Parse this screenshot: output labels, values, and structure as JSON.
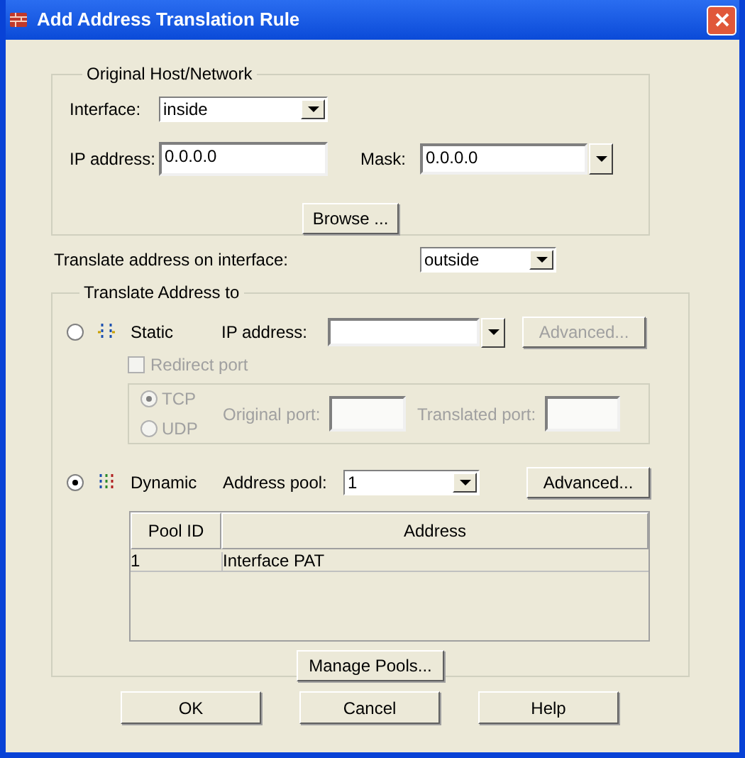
{
  "window": {
    "title": "Add Address Translation Rule"
  },
  "original": {
    "legend": "Original Host/Network",
    "interface_label": "Interface:",
    "interface_value": "inside",
    "ip_label": "IP address:",
    "ip_value": "0.0.0.0",
    "mask_label": "Mask:",
    "mask_value": "0.0.0.0",
    "browse": "Browse ..."
  },
  "translate_interface": {
    "label": "Translate address on interface:",
    "value": "outside"
  },
  "translate_to": {
    "legend": "Translate Address to",
    "static": {
      "label": "Static",
      "selected": false,
      "ip_label": "IP address:",
      "advanced": {
        "label": "Advanced...",
        "disabled": true
      }
    },
    "redirect_port": {
      "label": "Redirect port",
      "checked": false,
      "disabled": true
    },
    "protocols": [
      {
        "label": "TCP",
        "selected": true,
        "disabled": true
      },
      {
        "label": "UDP",
        "selected": false,
        "disabled": true
      }
    ],
    "ports": {
      "disabled": true,
      "original_label": "Original port:",
      "translated_label": "Translated port:"
    },
    "dynamic": {
      "label": "Dynamic",
      "selected": true,
      "pool_label": "Address pool:",
      "pool_value": "1",
      "advanced": {
        "label": "Advanced...",
        "disabled": false
      }
    },
    "table": {
      "columns": [
        "Pool ID",
        "Address"
      ],
      "rows": [
        [
          "1",
          "Interface PAT"
        ]
      ]
    },
    "manage_pools": "Manage Pools..."
  },
  "buttons": [
    "OK",
    "Cancel",
    "Help"
  ]
}
